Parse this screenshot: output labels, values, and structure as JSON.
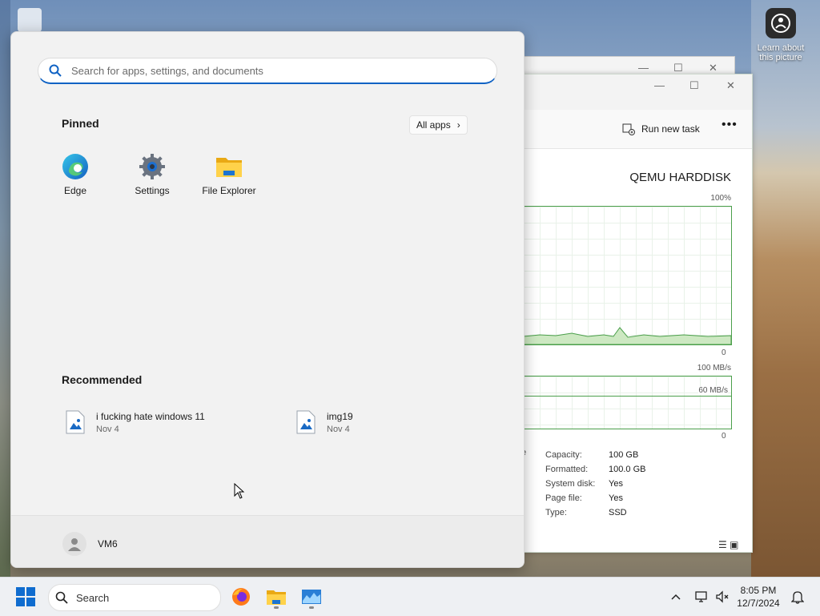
{
  "desktop": {
    "learn_picture_label": "Learn about this picture"
  },
  "task_manager": {
    "run_new_task_label": "Run new task",
    "disk_title": "QEMU HARDDISK",
    "activity_max_label": "100%",
    "activity_min_label": "0",
    "transfer_max_label": "100 MB/s",
    "transfer_mid_label": "60 MB/s",
    "transfer_min_label": "0",
    "left_cut_text": "e",
    "properties": [
      {
        "key": "Capacity:",
        "value": "100 GB"
      },
      {
        "key": "Formatted:",
        "value": "100.0 GB"
      },
      {
        "key": "System disk:",
        "value": "Yes"
      },
      {
        "key": "Page file:",
        "value": "Yes"
      },
      {
        "key": "Type:",
        "value": "SSD"
      }
    ]
  },
  "start_menu": {
    "search_placeholder": "Search for apps, settings, and documents",
    "pinned_title": "Pinned",
    "all_apps_label": "All apps",
    "pinned": [
      {
        "label": "Edge",
        "icon": "edge-icon"
      },
      {
        "label": "Settings",
        "icon": "gear-icon"
      },
      {
        "label": "File Explorer",
        "icon": "folder-icon"
      }
    ],
    "recommended_title": "Recommended",
    "recommended": [
      {
        "name": "i fucking hate windows 11",
        "date": "Nov 4",
        "icon": "image-file-icon"
      },
      {
        "name": "img19",
        "date": "Nov 4",
        "icon": "image-file-icon"
      }
    ],
    "user_name": "VM6"
  },
  "taskbar": {
    "search_label": "Search",
    "time": "8:05 PM",
    "date": "12/7/2024",
    "accent": "#0f62c4"
  }
}
